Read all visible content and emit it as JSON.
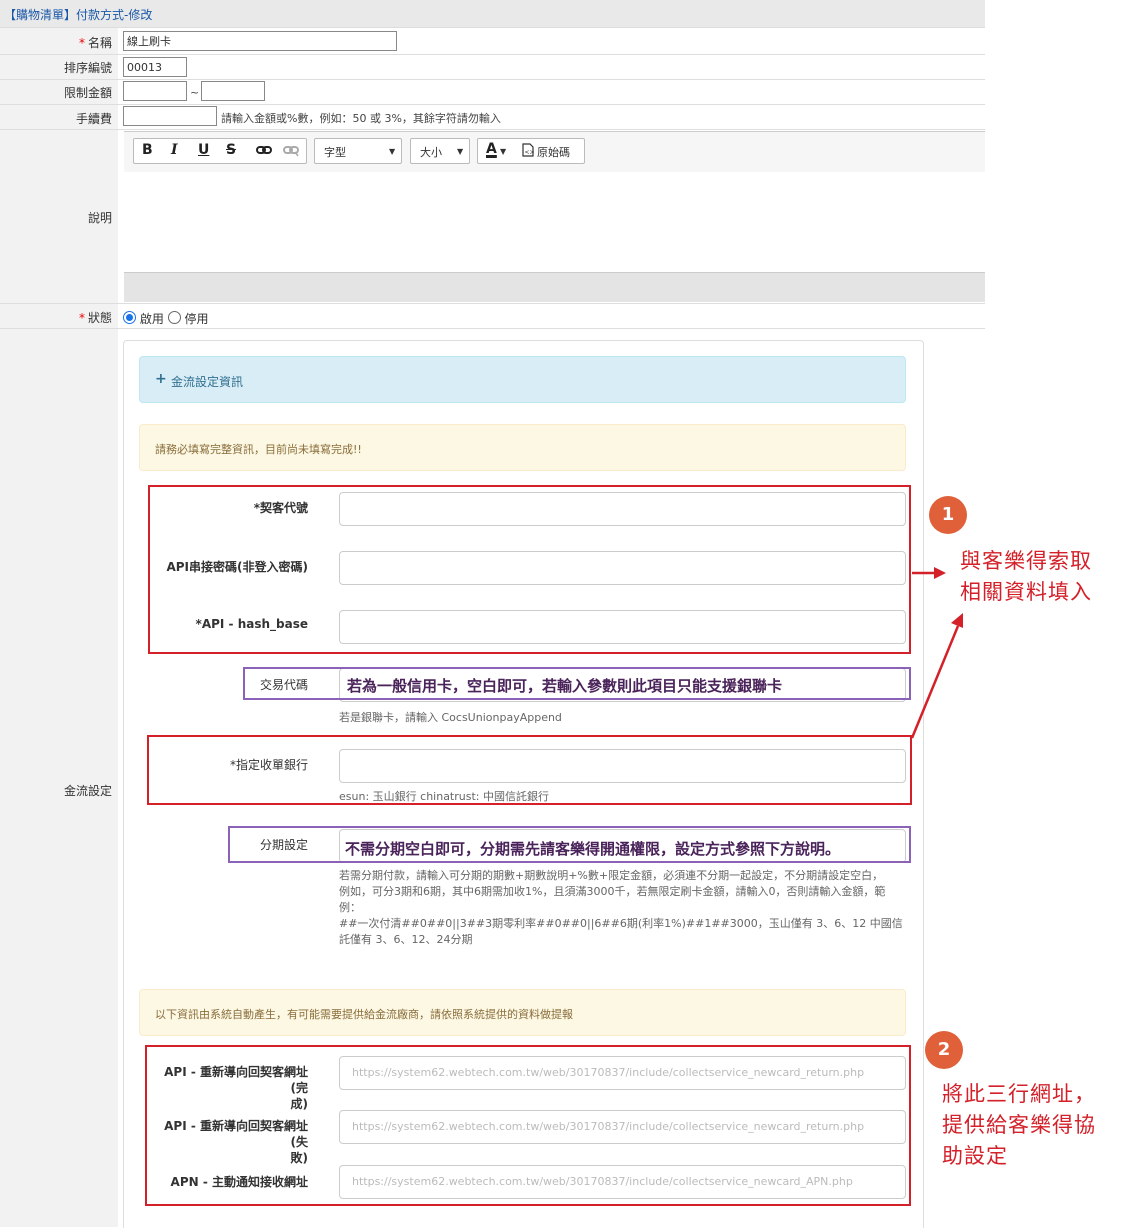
{
  "header": {
    "title": "【購物清單】付款方式-修改"
  },
  "form": {
    "name": {
      "label": "名稱",
      "value": "線上刷卡"
    },
    "sort": {
      "label": "排序編號",
      "value": "00013"
    },
    "limit": {
      "label": "限制金額",
      "from": "",
      "to": "",
      "sep": "~"
    },
    "fee": {
      "label": "手續費",
      "value": "",
      "hint": "請輸入金額或%數，例如：50 或 3%，其餘字符請勿輸入"
    },
    "desc": {
      "label": "說明"
    },
    "status": {
      "label": "狀態",
      "options": [
        "啟用",
        "停用"
      ],
      "selected": "啟用"
    },
    "gateway": {
      "label": "金流設定"
    }
  },
  "toolbar": {
    "bold": "B",
    "italic": "I",
    "underline": "U",
    "strike": "S",
    "font_label": "字型",
    "size_label": "大小",
    "color_label": "A",
    "source_label": "原始碼"
  },
  "gateway_panel": {
    "info_title": "金流設定資訊",
    "warning_top": "請務必填寫完整資訊，目前尚未填寫完成!!",
    "merchant_id_label": "*契客代號",
    "api_key_label": "API串接密碼(非登入密碼)",
    "hash_base_label": "*API - hash_base",
    "trade_code_label": "交易代碼",
    "trade_code_help": "若是銀聯卡，請輸入 CocsUnionpayAppend",
    "bank_label": "*指定收單銀行",
    "bank_help": "esun: 玉山銀行 chinatrust: 中國信託銀行",
    "installment_label": "分期設定",
    "installment_help_1": "若需分期付款，請輸入可分期的期數+期數說明+%數+限定金額，必須連不分期一起設定，不分期請設定空白，",
    "installment_help_2": "例如，可分3期和6期，其中6期需加收1%，且須滿3000千，若無限定刷卡金額，請輸入0，否則請輸入金額，範例：",
    "installment_help_3": "##一次付清##0##0||3##3期零利率##0##0||6##6期(利率1%)##1##3000，玉山僅有 3、6、12 中國信託僅有 3、6、12、24分期",
    "warning_bottom": "以下資訊由系統自動產生，有可能需要提供給金流廠商，請依照系統提供的資料做提報",
    "return_ok_label_1": "API - 重新導向回契客網址(完",
    "return_ok_label_2": "成)",
    "return_ok_url": "https://system62.webtech.com.tw/web/30170837/include/collectservice_newcard_return.php",
    "return_fail_label_1": "API - 重新導向回契客網址(失",
    "return_fail_label_2": "敗)",
    "return_fail_url": "https://system62.webtech.com.tw/web/30170837/include/collectservice_newcard_return.php",
    "apn_label": "APN - 主動通知接收網址",
    "apn_url": "https://system62.webtech.com.tw/web/30170837/include/collectservice_newcard_APN.php"
  },
  "annotations": {
    "badge_1": "1",
    "badge_2": "2",
    "note_1_line1": "與客樂得索取",
    "note_1_line2": "相關資料填入",
    "note_2_line1": "將此三行網址，",
    "note_2_line2": "提供給客樂得協",
    "note_2_line3": "助設定",
    "overlay_trade": "若為一般信用卡，空白即可，若輸入參數則此項目只能支援銀聯卡",
    "overlay_installment": "不需分期空白即可，分期需先請客樂得開通權限，設定方式參照下方說明。"
  },
  "colors": {
    "accent_red": "#d32029",
    "accent_purple": "#8a63b8",
    "badge": "#e0603a",
    "info_bg": "#d9edf7",
    "warn_bg": "#fcf8e3"
  }
}
